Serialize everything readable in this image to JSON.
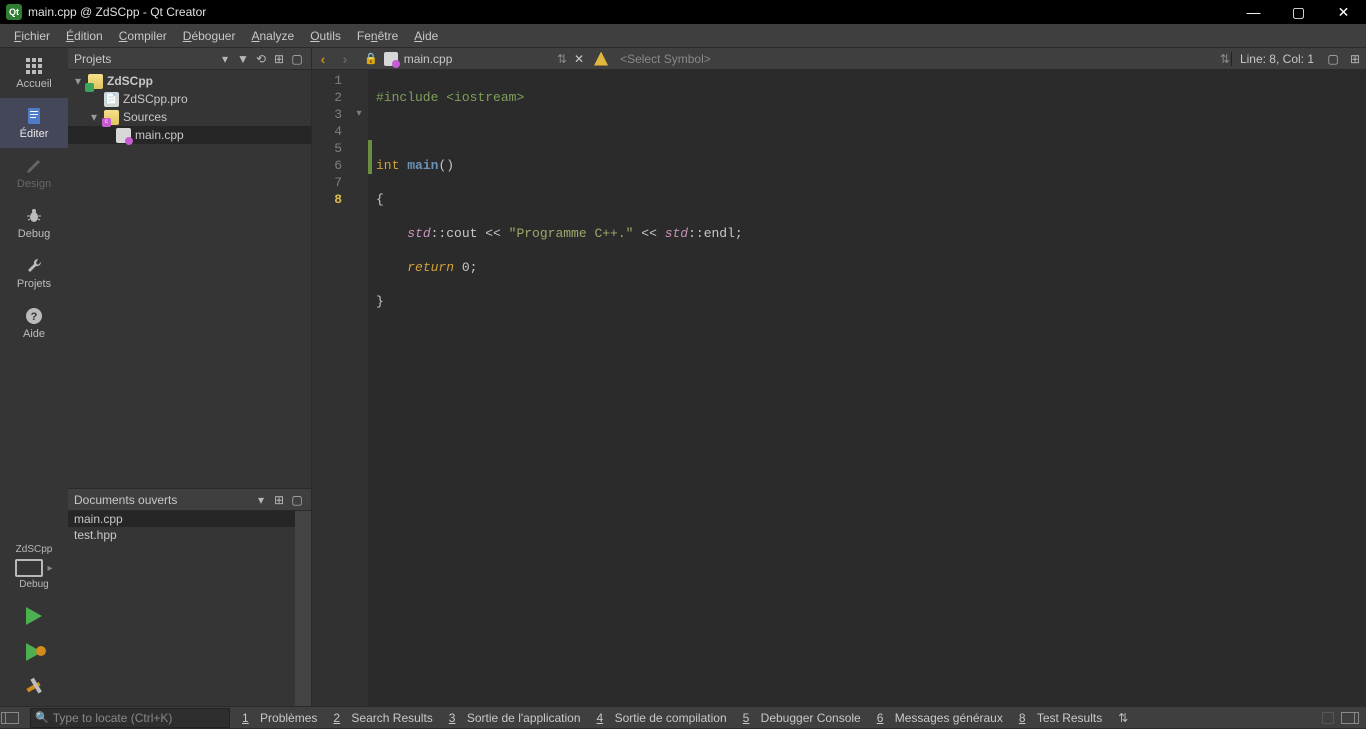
{
  "window": {
    "title": "main.cpp @ ZdSCpp - Qt Creator",
    "app_icon_text": "Qt"
  },
  "menubar": [
    "Fichier",
    "Édition",
    "Compiler",
    "Déboguer",
    "Analyze",
    "Outils",
    "Fenêtre",
    "Aide"
  ],
  "modebar": {
    "items": [
      {
        "label": "Accueil"
      },
      {
        "label": "Éditer"
      },
      {
        "label": "Design"
      },
      {
        "label": "Debug"
      },
      {
        "label": "Projets"
      },
      {
        "label": "Aide"
      }
    ],
    "kit": "ZdSCpp",
    "target": "Debug"
  },
  "projects_panel": {
    "title": "Projets",
    "tree": {
      "root": "ZdSCpp",
      "pro_file": "ZdSCpp.pro",
      "sources_folder": "Sources",
      "main_file": "main.cpp"
    }
  },
  "open_docs": {
    "title": "Documents ouverts",
    "items": [
      "main.cpp",
      "test.hpp"
    ],
    "active": "main.cpp"
  },
  "editor": {
    "file": "main.cpp",
    "symbol_placeholder": "<Select Symbol>",
    "cursor": "Line: 8, Col: 1",
    "line_numbers": [
      "1",
      "2",
      "3",
      "4",
      "5",
      "6",
      "7",
      "8"
    ],
    "current_line": 8,
    "code_plain": [
      "#include <iostream>",
      "",
      "int main()",
      "{",
      "    std::cout << \"Programme C++.\" << std::endl;",
      "    return 0;",
      "}",
      ""
    ]
  },
  "statusbar": {
    "locator_placeholder": "Type to locate (Ctrl+K)",
    "items": [
      {
        "key": "1",
        "label": "Problèmes"
      },
      {
        "key": "2",
        "label": "Search Results"
      },
      {
        "key": "3",
        "label": "Sortie de l'application"
      },
      {
        "key": "4",
        "label": "Sortie de compilation"
      },
      {
        "key": "5",
        "label": "Debugger Console"
      },
      {
        "key": "6",
        "label": "Messages généraux"
      },
      {
        "key": "8",
        "label": "Test Results"
      }
    ]
  }
}
